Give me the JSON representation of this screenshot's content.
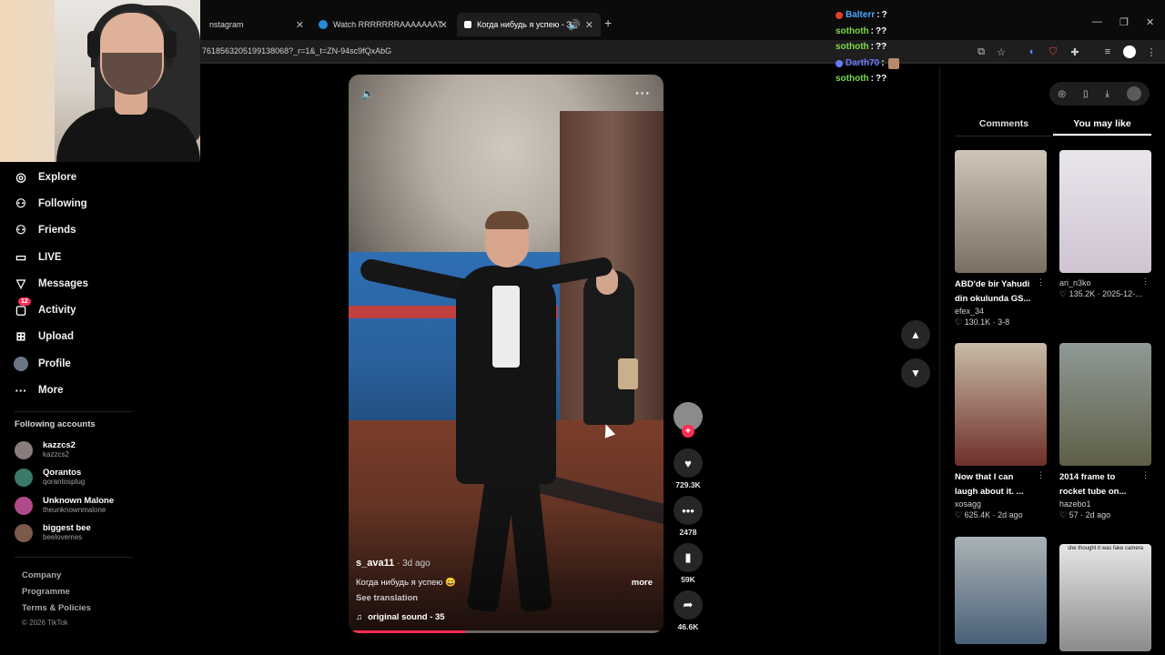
{
  "browser": {
    "tabs": [
      {
        "title": "nstagram"
      },
      {
        "title": "Watch RRRRRRRAAAAAAAT"
      },
      {
        "title": "Когда нибудь я успею - Зв"
      }
    ],
    "url": "7618563205199138068?_r=1&_t=ZN-94sc9fQxAbG",
    "new_tab": "+"
  },
  "chat": [
    {
      "user": "Balterr",
      "msg": "?",
      "color": "#4aa8ff",
      "badge": "#e0402a"
    },
    {
      "user": "sothoth",
      "msg": "??",
      "color": "#7bd94f",
      "badge": ""
    },
    {
      "user": "sothoth",
      "msg": "??",
      "color": "#7bd94f",
      "badge": ""
    },
    {
      "user": "Darth70",
      "msg": "",
      "color": "#6b7bff",
      "badge": "#6b7bff"
    },
    {
      "user": "sothoth",
      "msg": "??",
      "color": "#7bd94f",
      "badge": ""
    }
  ],
  "nav": [
    {
      "label": "Explore",
      "icon": "compass-icon",
      "glyph": "◎"
    },
    {
      "label": "Following",
      "icon": "user-follow-icon",
      "glyph": "⚇"
    },
    {
      "label": "Friends",
      "icon": "friends-icon",
      "glyph": "⚇"
    },
    {
      "label": "LIVE",
      "icon": "live-tv-icon",
      "glyph": "▭"
    },
    {
      "label": "Messages",
      "icon": "messages-icon",
      "glyph": "▽"
    },
    {
      "label": "Activity",
      "icon": "activity-icon",
      "glyph": "▢",
      "badge": "12"
    },
    {
      "label": "Upload",
      "icon": "upload-icon",
      "glyph": "⊞"
    },
    {
      "label": "Profile",
      "icon": "profile-avatar",
      "glyph": ""
    },
    {
      "label": "More",
      "icon": "more-icon",
      "glyph": "···"
    }
  ],
  "following": {
    "title": "Following accounts",
    "accounts": [
      {
        "name": "kazzcs2",
        "handle": "kazzcs2",
        "color": "#8a7c7c"
      },
      {
        "name": "Qorantos",
        "handle": "qorantosplug",
        "color": "#3a7a6a"
      },
      {
        "name": "Unknown Malone",
        "handle": "theunknownmalone",
        "color": "#b04a8a"
      },
      {
        "name": "biggest bee",
        "handle": "beelovemes",
        "color": "#7a5a4a"
      }
    ]
  },
  "footer": {
    "company": "Company",
    "programme": "Programme",
    "terms": "Terms & Policies",
    "copyright": "© 2026 TikTok"
  },
  "video": {
    "author": "s_ava11",
    "date": " · 3d ago",
    "caption": "Когда нибудь я успею 😄",
    "more": "more",
    "see_translation": "See translation",
    "sound": "original sound - 35",
    "progress": 0.37
  },
  "actions": {
    "likes": "729.3K",
    "comments": "2478",
    "saves": "59K",
    "shares": "46.6K"
  },
  "right_panel": {
    "tabs": [
      "Comments",
      "You may like"
    ],
    "active_tab": 1,
    "cards": [
      {
        "title": "ABD'de bir Yahudi din okulunda GS...",
        "author": "efex_34",
        "stats": "130.1K · 3-8",
        "bg": "linear-gradient(180deg,#cfc6b8,#7b6f62)"
      },
      {
        "title": "",
        "author": "ari_n3ko",
        "stats": "135.2K · 2025-12-...",
        "bg": "linear-gradient(180deg,#e9e6ec,#cfc3d2)"
      },
      {
        "title": "Now that I can laugh about it. ...",
        "author": "xosagg",
        "stats": "625.4K · 2d ago",
        "bg": "linear-gradient(180deg,#c8bba6,#6e2f2a)"
      },
      {
        "title": "2014 frame to rocket tube on...",
        "author": "hazebo1",
        "stats": "57 · 2d ago",
        "bg": "linear-gradient(180deg,#8f9a96,#5e5e46)"
      },
      {
        "title": "",
        "author": "",
        "stats": "",
        "bg": "linear-gradient(180deg,#aab3b6,#4a6078)"
      },
      {
        "title": "she thought it was fake camera",
        "author": "",
        "stats": "",
        "bg": "linear-gradient(180deg,#e6e6e6,#8a8a8a)"
      }
    ]
  }
}
